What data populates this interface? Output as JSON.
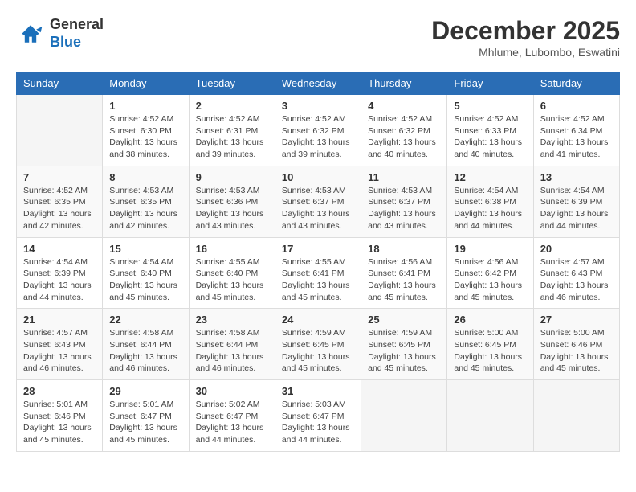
{
  "logo": {
    "general": "General",
    "blue": "Blue"
  },
  "header": {
    "month_year": "December 2025",
    "location": "Mhlume, Lubombo, Eswatini"
  },
  "columns": [
    "Sunday",
    "Monday",
    "Tuesday",
    "Wednesday",
    "Thursday",
    "Friday",
    "Saturday"
  ],
  "weeks": [
    [
      {
        "day": "",
        "info": ""
      },
      {
        "day": "1",
        "info": "Sunrise: 4:52 AM\nSunset: 6:30 PM\nDaylight: 13 hours\nand 38 minutes."
      },
      {
        "day": "2",
        "info": "Sunrise: 4:52 AM\nSunset: 6:31 PM\nDaylight: 13 hours\nand 39 minutes."
      },
      {
        "day": "3",
        "info": "Sunrise: 4:52 AM\nSunset: 6:32 PM\nDaylight: 13 hours\nand 39 minutes."
      },
      {
        "day": "4",
        "info": "Sunrise: 4:52 AM\nSunset: 6:32 PM\nDaylight: 13 hours\nand 40 minutes."
      },
      {
        "day": "5",
        "info": "Sunrise: 4:52 AM\nSunset: 6:33 PM\nDaylight: 13 hours\nand 40 minutes."
      },
      {
        "day": "6",
        "info": "Sunrise: 4:52 AM\nSunset: 6:34 PM\nDaylight: 13 hours\nand 41 minutes."
      }
    ],
    [
      {
        "day": "7",
        "info": "Sunrise: 4:52 AM\nSunset: 6:35 PM\nDaylight: 13 hours\nand 42 minutes."
      },
      {
        "day": "8",
        "info": "Sunrise: 4:53 AM\nSunset: 6:35 PM\nDaylight: 13 hours\nand 42 minutes."
      },
      {
        "day": "9",
        "info": "Sunrise: 4:53 AM\nSunset: 6:36 PM\nDaylight: 13 hours\nand 43 minutes."
      },
      {
        "day": "10",
        "info": "Sunrise: 4:53 AM\nSunset: 6:37 PM\nDaylight: 13 hours\nand 43 minutes."
      },
      {
        "day": "11",
        "info": "Sunrise: 4:53 AM\nSunset: 6:37 PM\nDaylight: 13 hours\nand 43 minutes."
      },
      {
        "day": "12",
        "info": "Sunrise: 4:54 AM\nSunset: 6:38 PM\nDaylight: 13 hours\nand 44 minutes."
      },
      {
        "day": "13",
        "info": "Sunrise: 4:54 AM\nSunset: 6:39 PM\nDaylight: 13 hours\nand 44 minutes."
      }
    ],
    [
      {
        "day": "14",
        "info": "Sunrise: 4:54 AM\nSunset: 6:39 PM\nDaylight: 13 hours\nand 44 minutes."
      },
      {
        "day": "15",
        "info": "Sunrise: 4:54 AM\nSunset: 6:40 PM\nDaylight: 13 hours\nand 45 minutes."
      },
      {
        "day": "16",
        "info": "Sunrise: 4:55 AM\nSunset: 6:40 PM\nDaylight: 13 hours\nand 45 minutes."
      },
      {
        "day": "17",
        "info": "Sunrise: 4:55 AM\nSunset: 6:41 PM\nDaylight: 13 hours\nand 45 minutes."
      },
      {
        "day": "18",
        "info": "Sunrise: 4:56 AM\nSunset: 6:41 PM\nDaylight: 13 hours\nand 45 minutes."
      },
      {
        "day": "19",
        "info": "Sunrise: 4:56 AM\nSunset: 6:42 PM\nDaylight: 13 hours\nand 45 minutes."
      },
      {
        "day": "20",
        "info": "Sunrise: 4:57 AM\nSunset: 6:43 PM\nDaylight: 13 hours\nand 46 minutes."
      }
    ],
    [
      {
        "day": "21",
        "info": "Sunrise: 4:57 AM\nSunset: 6:43 PM\nDaylight: 13 hours\nand 46 minutes."
      },
      {
        "day": "22",
        "info": "Sunrise: 4:58 AM\nSunset: 6:44 PM\nDaylight: 13 hours\nand 46 minutes."
      },
      {
        "day": "23",
        "info": "Sunrise: 4:58 AM\nSunset: 6:44 PM\nDaylight: 13 hours\nand 46 minutes."
      },
      {
        "day": "24",
        "info": "Sunrise: 4:59 AM\nSunset: 6:45 PM\nDaylight: 13 hours\nand 45 minutes."
      },
      {
        "day": "25",
        "info": "Sunrise: 4:59 AM\nSunset: 6:45 PM\nDaylight: 13 hours\nand 45 minutes."
      },
      {
        "day": "26",
        "info": "Sunrise: 5:00 AM\nSunset: 6:45 PM\nDaylight: 13 hours\nand 45 minutes."
      },
      {
        "day": "27",
        "info": "Sunrise: 5:00 AM\nSunset: 6:46 PM\nDaylight: 13 hours\nand 45 minutes."
      }
    ],
    [
      {
        "day": "28",
        "info": "Sunrise: 5:01 AM\nSunset: 6:46 PM\nDaylight: 13 hours\nand 45 minutes."
      },
      {
        "day": "29",
        "info": "Sunrise: 5:01 AM\nSunset: 6:47 PM\nDaylight: 13 hours\nand 45 minutes."
      },
      {
        "day": "30",
        "info": "Sunrise: 5:02 AM\nSunset: 6:47 PM\nDaylight: 13 hours\nand 44 minutes."
      },
      {
        "day": "31",
        "info": "Sunrise: 5:03 AM\nSunset: 6:47 PM\nDaylight: 13 hours\nand 44 minutes."
      },
      {
        "day": "",
        "info": ""
      },
      {
        "day": "",
        "info": ""
      },
      {
        "day": "",
        "info": ""
      }
    ]
  ]
}
